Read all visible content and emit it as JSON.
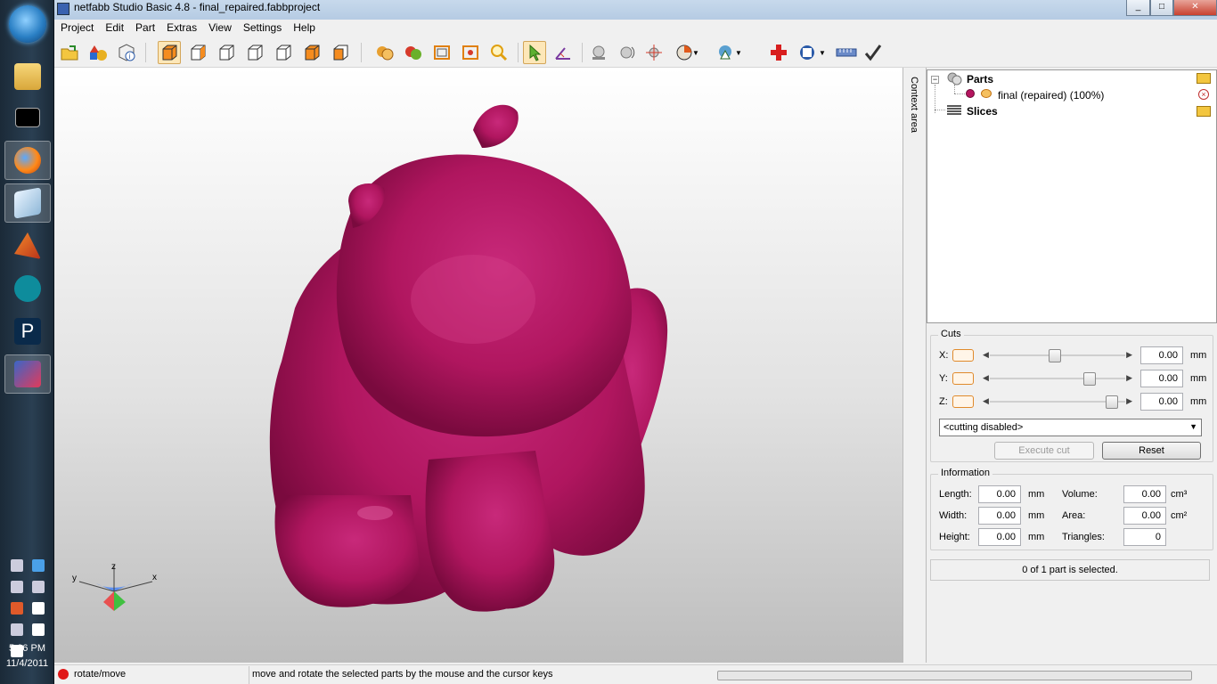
{
  "window": {
    "title": "netfabb Studio Basic 4.8 - final_repaired.fabbproject"
  },
  "menu": [
    "Project",
    "Edit",
    "Part",
    "Extras",
    "View",
    "Settings",
    "Help"
  ],
  "viewport": {
    "model_color": "#b5155f",
    "axis_labels": {
      "x": "x",
      "y": "y",
      "z": "z"
    }
  },
  "side_label": "Context area",
  "tree": {
    "parts": "Parts",
    "part_item": "final (repaired) (100%)",
    "slices": "Slices"
  },
  "cuts": {
    "title": "Cuts",
    "x_label": "X:",
    "y_label": "Y:",
    "z_label": "Z:",
    "x_value": "0.00",
    "y_value": "0.00",
    "z_value": "0.00",
    "unit": "mm",
    "x_pos": 0.48,
    "y_pos": 0.76,
    "z_pos": 0.94,
    "mode": "<cutting disabled>",
    "execute": "Execute cut",
    "reset": "Reset"
  },
  "info": {
    "title": "Information",
    "length_label": "Length:",
    "length": "0.00",
    "width_label": "Width:",
    "width": "0.00",
    "height_label": "Height:",
    "height": "0.00",
    "mm": "mm",
    "volume_label": "Volume:",
    "volume": "0.00",
    "area_label": "Area:",
    "area": "0.00",
    "cm3": "cm³",
    "cm2": "cm²",
    "triangles_label": "Triangles:",
    "triangles": "0"
  },
  "selection": "0 of 1 part is selected.",
  "status": {
    "mode": "rotate/move",
    "hint": "move and rotate the selected parts by the mouse and the cursor keys"
  },
  "clock": {
    "time": "5:06 PM",
    "date": "11/4/2011"
  }
}
